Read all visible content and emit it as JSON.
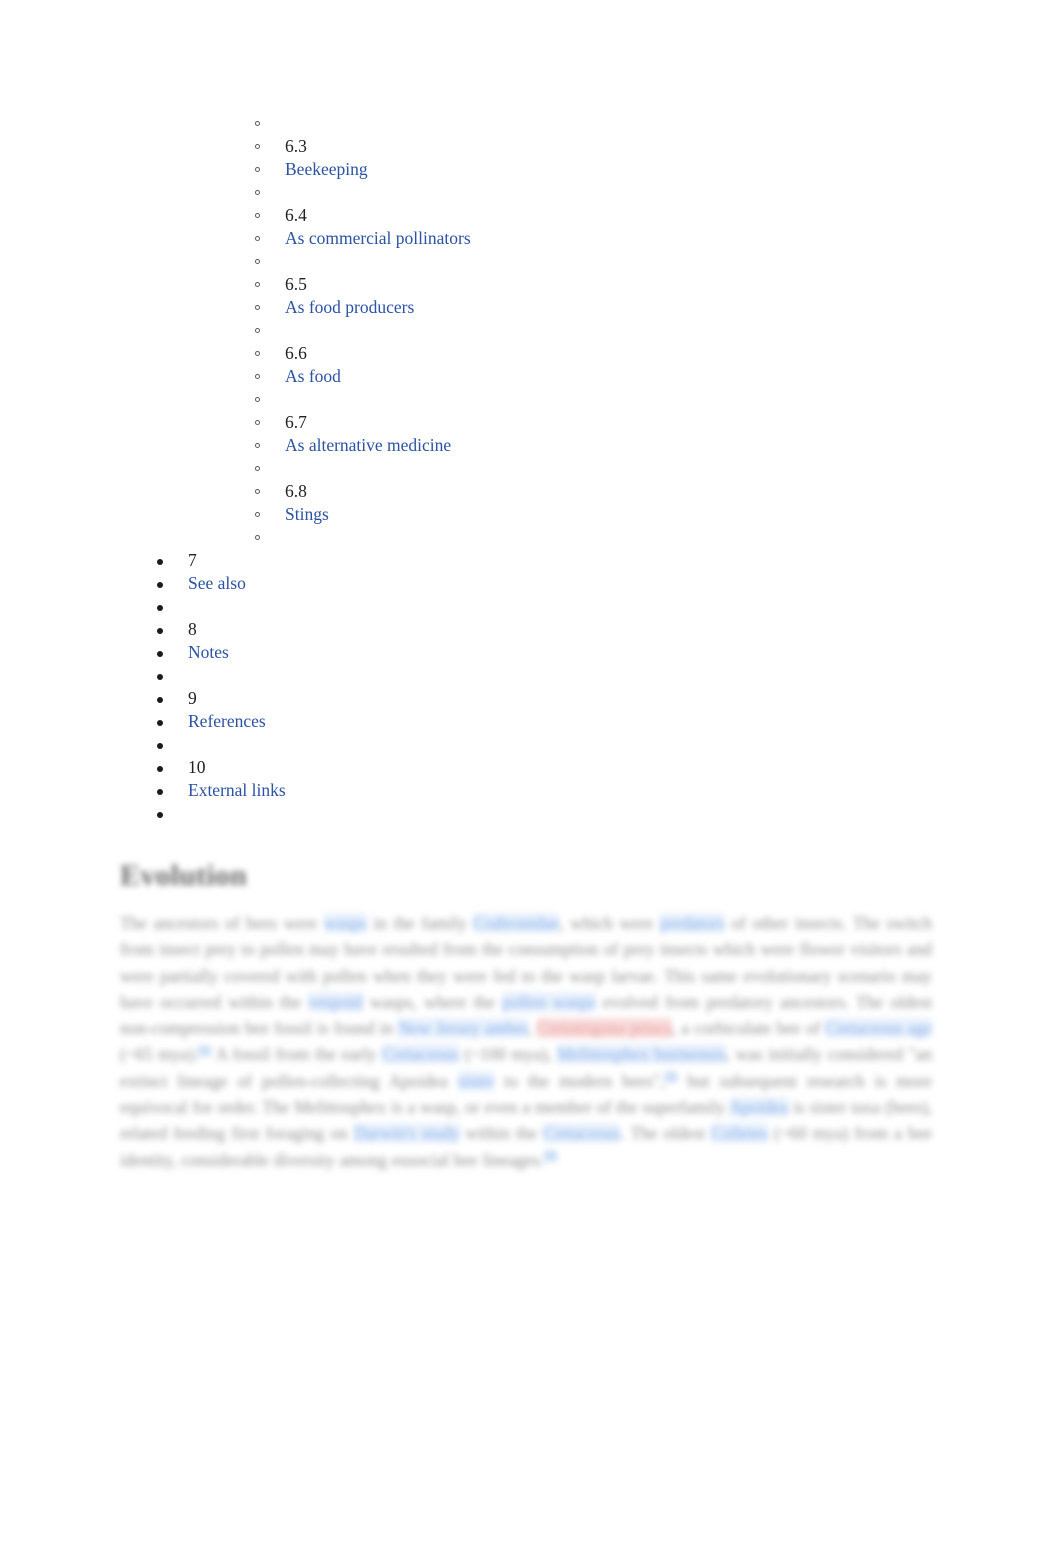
{
  "document": {
    "toc": {
      "name": "table-of-contents",
      "rows": [
        {
          "level": 2,
          "kind": "spacer",
          "text": ""
        },
        {
          "level": 2,
          "kind": "number",
          "text": "6.3"
        },
        {
          "level": 2,
          "kind": "link",
          "text": "Beekeeping"
        },
        {
          "level": 2,
          "kind": "spacer",
          "text": ""
        },
        {
          "level": 2,
          "kind": "number",
          "text": "6.4"
        },
        {
          "level": 2,
          "kind": "link",
          "text": "As commercial pollinators"
        },
        {
          "level": 2,
          "kind": "spacer",
          "text": ""
        },
        {
          "level": 2,
          "kind": "number",
          "text": "6.5"
        },
        {
          "level": 2,
          "kind": "link",
          "text": "As food producers"
        },
        {
          "level": 2,
          "kind": "spacer",
          "text": ""
        },
        {
          "level": 2,
          "kind": "number",
          "text": "6.6"
        },
        {
          "level": 2,
          "kind": "link",
          "text": "As food"
        },
        {
          "level": 2,
          "kind": "spacer",
          "text": ""
        },
        {
          "level": 2,
          "kind": "number",
          "text": "6.7"
        },
        {
          "level": 2,
          "kind": "link",
          "text": "As alternative medicine"
        },
        {
          "level": 2,
          "kind": "spacer",
          "text": ""
        },
        {
          "level": 2,
          "kind": "number",
          "text": "6.8"
        },
        {
          "level": 2,
          "kind": "link",
          "text": "Stings"
        },
        {
          "level": 2,
          "kind": "spacer",
          "text": ""
        },
        {
          "level": 1,
          "kind": "number",
          "text": "7"
        },
        {
          "level": 1,
          "kind": "link",
          "text": "See also"
        },
        {
          "level": 1,
          "kind": "spacer",
          "text": ""
        },
        {
          "level": 1,
          "kind": "number",
          "text": "8"
        },
        {
          "level": 1,
          "kind": "link",
          "text": "Notes"
        },
        {
          "level": 1,
          "kind": "spacer",
          "text": ""
        },
        {
          "level": 1,
          "kind": "number",
          "text": "9"
        },
        {
          "level": 1,
          "kind": "link",
          "text": "References"
        },
        {
          "level": 1,
          "kind": "spacer",
          "text": ""
        },
        {
          "level": 1,
          "kind": "number",
          "text": "10"
        },
        {
          "level": 1,
          "kind": "link",
          "text": "External links"
        },
        {
          "level": 1,
          "kind": "spacer",
          "text": ""
        }
      ]
    },
    "article": {
      "heading": "Evolution",
      "paragraph_segments": [
        {
          "type": "text",
          "text": "The ancestors of bees were "
        },
        {
          "type": "link",
          "text": "wasps"
        },
        {
          "type": "text",
          "text": " in the family "
        },
        {
          "type": "link",
          "text": "Crabronidae"
        },
        {
          "type": "text",
          "text": ", which were "
        },
        {
          "type": "link",
          "text": "predators"
        },
        {
          "type": "text",
          "text": " of other insects. The switch from insect prey to pollen may have resulted from the consumption of prey insects which were flower visitors and were partially covered with pollen when they were fed to the wasp larvae. This same evolutionary scenario may have occurred within the "
        },
        {
          "type": "link",
          "text": "vespoid"
        },
        {
          "type": "text",
          "text": " wasps, where the "
        },
        {
          "type": "link",
          "text": "pollen wasps"
        },
        {
          "type": "text",
          "text": " evolved from predatory ancestors. The oldest non-compression bee fossil is found in "
        },
        {
          "type": "link",
          "text": "New Jersey amber"
        },
        {
          "type": "text",
          "text": ", "
        },
        {
          "type": "link-red",
          "text": "Cretotrigona prisca"
        },
        {
          "type": "text",
          "text": ", a corbiculate bee of "
        },
        {
          "type": "link",
          "text": "Cretaceous age"
        },
        {
          "type": "text",
          "text": " (~65 mya)."
        },
        {
          "type": "ref",
          "text": "[1]"
        },
        {
          "type": "text",
          "text": " A fossil from the early "
        },
        {
          "type": "link",
          "text": "Cretaceous"
        },
        {
          "type": "text",
          "text": " (~100 mya), "
        },
        {
          "type": "link",
          "text": "Melittosphex burmensis"
        },
        {
          "type": "text",
          "text": ", was initially considered \"an extinct lineage of pollen-collecting Apoidea "
        },
        {
          "type": "link",
          "text": "sister"
        },
        {
          "type": "text",
          "text": " to the modern bees\","
        },
        {
          "type": "ref",
          "text": "[2]"
        },
        {
          "type": "text",
          "text": " but subsequent research is more equivocal for order. The Melittosphex is a wasp, or even a member of the superfamily "
        },
        {
          "type": "link",
          "text": "Apoidea"
        },
        {
          "type": "text",
          "text": " is sister taxa (bees), related feeding first foraging on "
        },
        {
          "type": "link",
          "text": "Darwin's study"
        },
        {
          "type": "text",
          "text": " within the "
        },
        {
          "type": "link",
          "text": "Cretaceous"
        },
        {
          "type": "text",
          "text": ". The oldest "
        },
        {
          "type": "link",
          "text": "Colletes"
        },
        {
          "type": "text",
          "text": " (~60 mya) from a bee identity, considerable diversity among eusocial bee lineages."
        },
        {
          "type": "ref",
          "text": "[3]"
        }
      ]
    }
  }
}
